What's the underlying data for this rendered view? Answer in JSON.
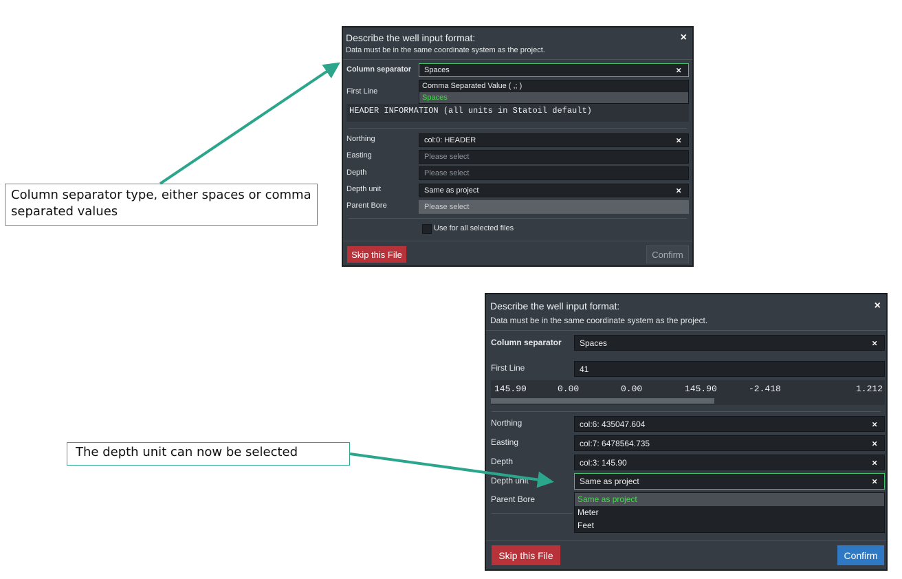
{
  "dialog1": {
    "title": "Describe the well input format:",
    "subtitle": "Data must be in the same coordinate system as the project.",
    "close": "×",
    "column_separator_label": "Column separator",
    "column_separator_value": "Spaces",
    "first_line_label": "First Line",
    "separator_options": [
      "Comma Separated Value ( ,; )",
      "Spaces"
    ],
    "preview_text": "HEADER INFORMATION (all units in Statoil default)",
    "northing_label": "Northing",
    "northing_value": "col:0: HEADER",
    "easting_label": "Easting",
    "easting_placeholder": "Please select",
    "depth_label": "Depth",
    "depth_placeholder": "Please select",
    "depth_unit_label": "Depth unit",
    "depth_unit_value": "Same as project",
    "parent_bore_label": "Parent Bore",
    "parent_bore_placeholder": "Please select",
    "use_all_label": "Use for all selected files",
    "skip_label": "Skip this File",
    "confirm_label": "Confirm",
    "clear": "×"
  },
  "dialog2": {
    "title": "Describe the well input format:",
    "subtitle": "Data must be in the same coordinate system as the project.",
    "close": "×",
    "column_separator_label": "Column separator",
    "column_separator_value": "Spaces",
    "first_line_label": "First Line",
    "first_line_value": "41",
    "preview_values": [
      "145.90",
      "0.00",
      "0.00",
      "145.90",
      "-2.418",
      "1.212"
    ],
    "northing_label": "Northing",
    "northing_value": "col:6: 435047.604",
    "easting_label": "Easting",
    "easting_value": "col:7: 6478564.735",
    "depth_label": "Depth",
    "depth_value": "col:3: 145.90",
    "depth_unit_label": "Depth unit",
    "depth_unit_value": "Same as project",
    "depth_unit_options": [
      "Same as project",
      "Meter",
      "Feet"
    ],
    "parent_bore_label": "Parent Bore",
    "skip_label": "Skip this File",
    "confirm_label": "Confirm",
    "clear": "×"
  },
  "callouts": {
    "separator_note": "Column separator type, either spaces or comma separated values",
    "depth_unit_note": "The depth unit can now be selected"
  },
  "colors": {
    "dialog_bg": "#353c44",
    "field_bg": "#1f2226",
    "focus_border": "#3ec26a",
    "selected_option": "#49d84f",
    "skip_button": "#b8323a",
    "confirm_button_active": "#2f79c4",
    "callout_border": "#2ca58d",
    "arrow": "#2ca58d"
  }
}
